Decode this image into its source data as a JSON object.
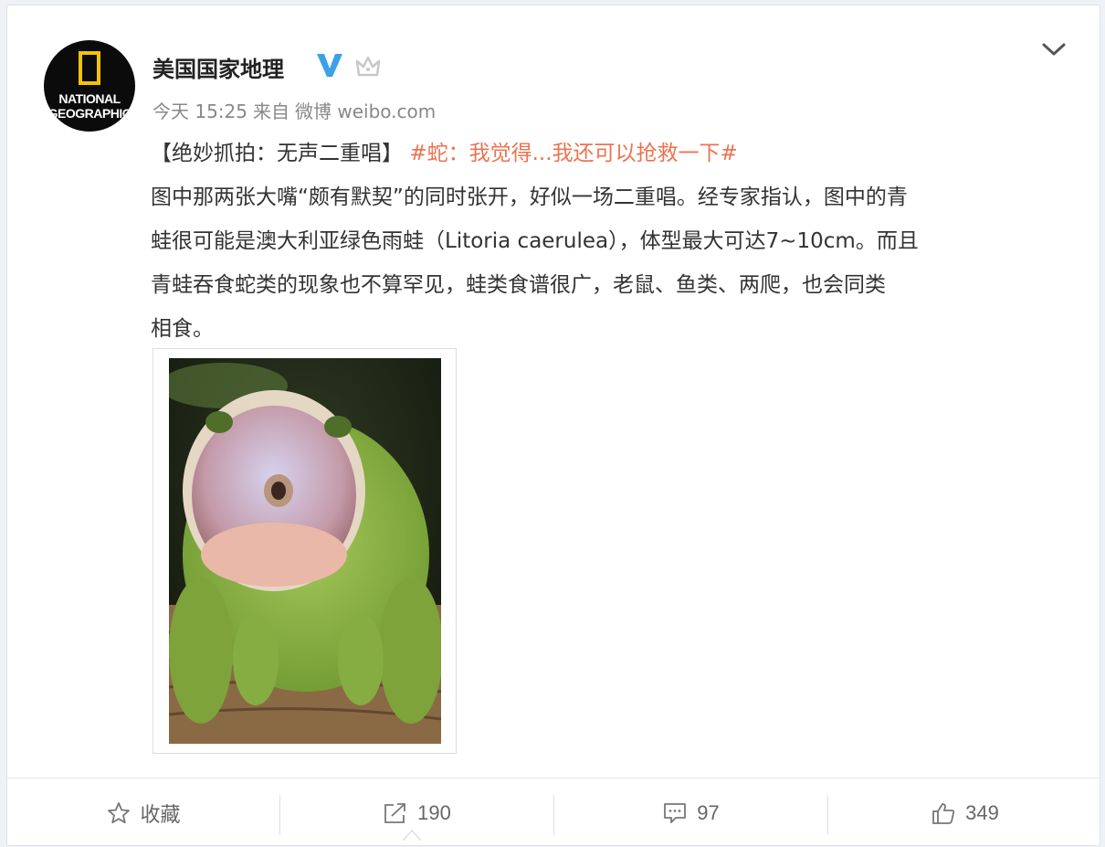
{
  "user": {
    "avatar_text_line1": "NATIONAL",
    "avatar_text_line2": "GEOGRAPHIC",
    "name": "美国国家地理",
    "icons": [
      "verified-v-icon",
      "crown-icon"
    ]
  },
  "meta": {
    "time": "今天 15:25",
    "from_label": "来自",
    "source": "微博 weibo.com"
  },
  "post": {
    "title": "【绝妙抓拍：无声二重唱】",
    "hashtag": "#蛇：我觉得...我还可以抢救一下#",
    "lines": [
      "图中那两张大嘴“颇有默契”的同时张开，好似一场二重唱。经专家指认，图中的青",
      "蛙很可能是澳大利亚绿色雨蛙（Litoria caerulea），体型最大可达7~10cm。而且",
      "青蛙吞食蛇类的现象也不算罕见，蛙类食谱很广，老鼠、鱼类、两爬，也会同类",
      "相食。"
    ]
  },
  "actions": {
    "favorite_label": "收藏",
    "repost_count": "190",
    "comment_count": "97",
    "like_count": "349"
  },
  "colors": {
    "hashtag": "#eb7350",
    "verified": "#3ba1e8",
    "ng_yellow": "#f5c400"
  }
}
